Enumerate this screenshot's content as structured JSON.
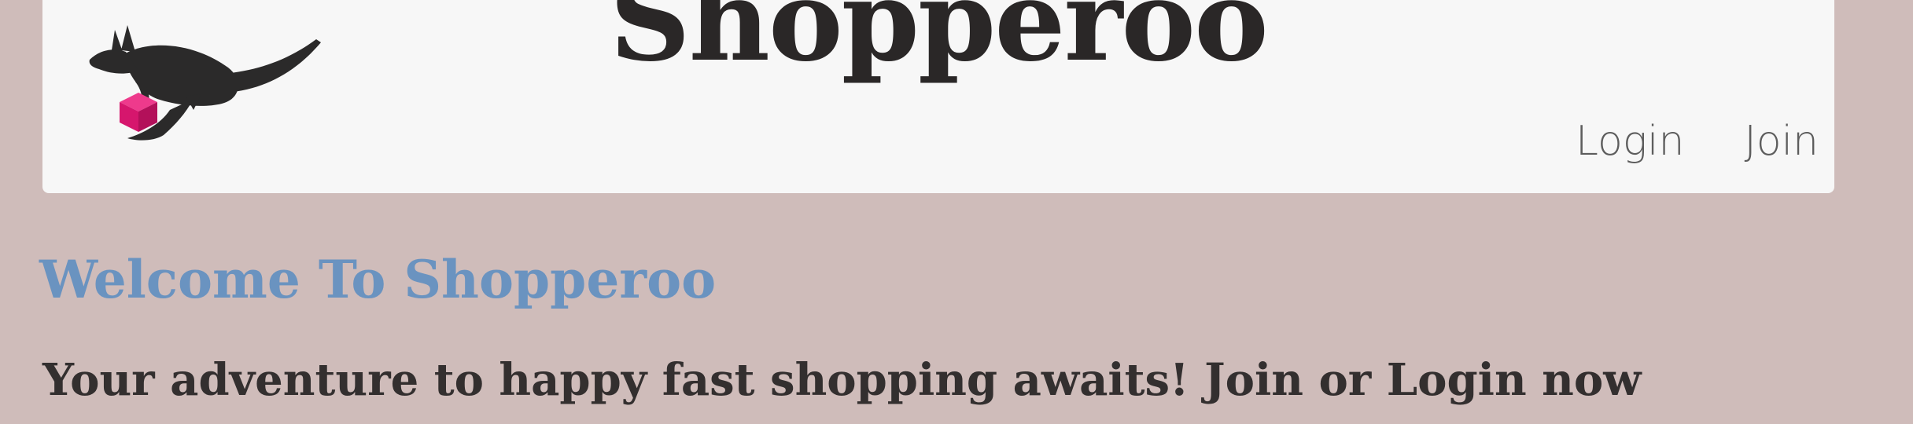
{
  "header": {
    "logo_icon": "kangaroo-with-box-icon",
    "brand_title": "Shopperoo",
    "nav": {
      "login_label": "Login",
      "join_label": "Join"
    }
  },
  "main": {
    "welcome_title": "Welcome To Shopperoo",
    "tagline": "Your adventure to happy fast shopping awaits! Join or Login now"
  },
  "colors": {
    "page_background": "#cfbcba",
    "navbar_background": "#f7f7f7",
    "brand_text": "#2a2727",
    "welcome_blue": "#6a93c0",
    "tagline_text": "#332f2f",
    "logo_box_pink": "#d6166d",
    "logo_kangaroo": "#2b2a2a"
  }
}
